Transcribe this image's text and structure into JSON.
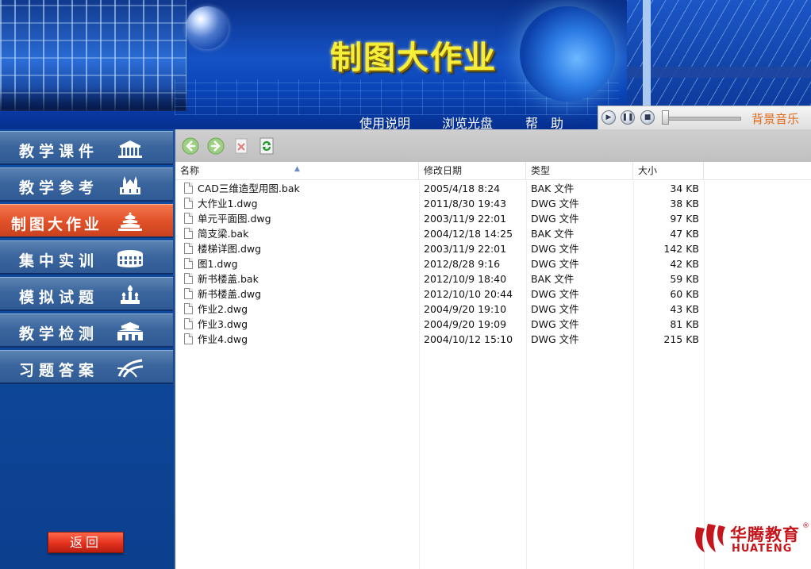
{
  "banner": {
    "title": "制图大作业",
    "nav": [
      "使用说明",
      "浏览光盘",
      "帮　助"
    ]
  },
  "music": {
    "label": "背景音乐",
    "play_icon": "play-icon",
    "pause_icon": "pause-icon",
    "stop_icon": "stop-icon"
  },
  "sidebar": {
    "items": [
      {
        "label": "教学课件",
        "icon": "pavilion-icon",
        "active": false
      },
      {
        "label": "教学参考",
        "icon": "cathedral-icon",
        "active": false
      },
      {
        "label": "制图大作业",
        "icon": "temple-of-heaven-icon",
        "active": true
      },
      {
        "label": "集中实训",
        "icon": "colosseum-icon",
        "active": false
      },
      {
        "label": "模拟试题",
        "icon": "onion-dome-icon",
        "active": false
      },
      {
        "label": "教学检测",
        "icon": "palace-gate-icon",
        "active": false
      },
      {
        "label": "习题答案",
        "icon": "highway-interchange-icon",
        "active": false
      }
    ],
    "back_label": "返回"
  },
  "explorer": {
    "toolbar": [
      "back-icon",
      "forward-icon",
      "delete-icon",
      "refresh-icon"
    ],
    "columns": [
      "名称",
      "修改日期",
      "类型",
      "大小"
    ],
    "files": [
      {
        "name": "CAD三维造型用图.bak",
        "date": "2005/4/18 8:24",
        "type": "BAK 文件",
        "size": "34 KB"
      },
      {
        "name": "大作业1.dwg",
        "date": "2011/8/30 19:43",
        "type": "DWG 文件",
        "size": "38 KB"
      },
      {
        "name": "单元平面图.dwg",
        "date": "2003/11/9 22:01",
        "type": "DWG 文件",
        "size": "97 KB"
      },
      {
        "name": "简支梁.bak",
        "date": "2004/12/18 14:25",
        "type": "BAK 文件",
        "size": "47 KB"
      },
      {
        "name": "楼梯详图.dwg",
        "date": "2003/11/9 22:01",
        "type": "DWG 文件",
        "size": "142 KB"
      },
      {
        "name": "图1.dwg",
        "date": "2012/8/28 9:16",
        "type": "DWG 文件",
        "size": "42 KB"
      },
      {
        "name": "新书楼盖.bak",
        "date": "2012/10/9 18:40",
        "type": "BAK 文件",
        "size": "59 KB"
      },
      {
        "name": "新书楼盖.dwg",
        "date": "2012/10/10 20:44",
        "type": "DWG 文件",
        "size": "60 KB"
      },
      {
        "name": "作业2.dwg",
        "date": "2004/9/20 19:10",
        "type": "DWG 文件",
        "size": "43 KB"
      },
      {
        "name": "作业3.dwg",
        "date": "2004/9/20 19:09",
        "type": "DWG 文件",
        "size": "81 KB"
      },
      {
        "name": "作业4.dwg",
        "date": "2004/10/12 15:10",
        "type": "DWG 文件",
        "size": "215 KB"
      }
    ]
  },
  "logo": {
    "cn": "华腾教育",
    "en": "HUATENG",
    "reg": "®",
    "color": "#c4161c"
  },
  "colors": {
    "active_menu": "#e2522a",
    "menu": "#3b669e",
    "title": "#f6ef3a",
    "music_label": "#e06a1c"
  }
}
